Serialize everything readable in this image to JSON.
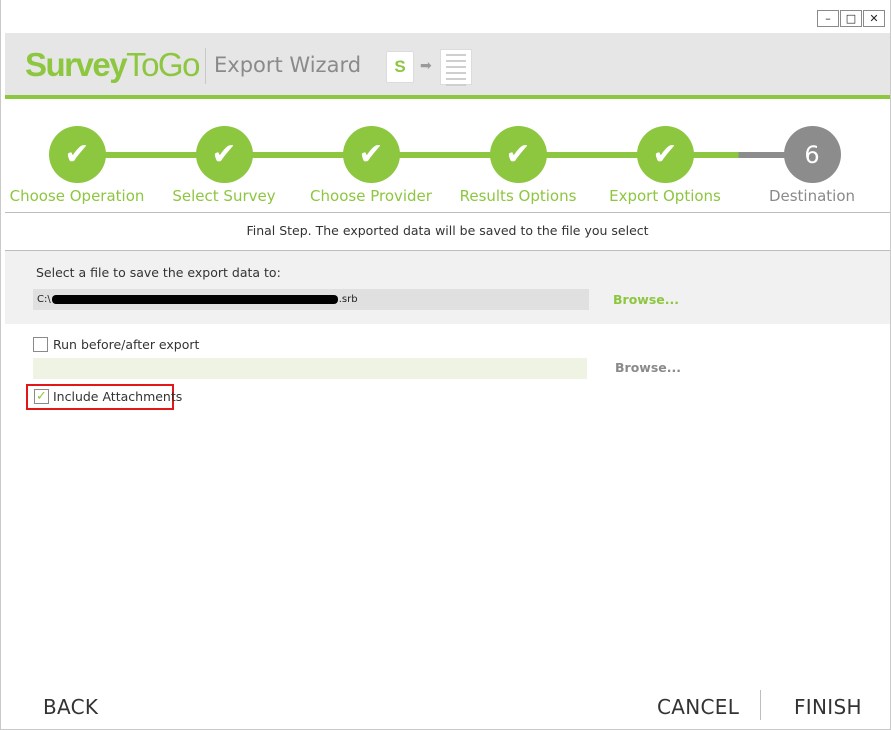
{
  "window": {
    "controls": {
      "minimize": "–",
      "maximize": "□",
      "close": "✕"
    }
  },
  "header": {
    "logo_part1": "Survey",
    "logo_part2": "ToGo",
    "title": "Export Wizard",
    "icon_letter": "S",
    "icon_arrow": "➡"
  },
  "colors": {
    "accent_green": "#8dc63f",
    "step_current_gray": "#8c8c8c",
    "highlight_red": "#e01818"
  },
  "steps": [
    {
      "label": "Choose Operation",
      "state": "done",
      "glyph": "✔"
    },
    {
      "label": "Select Survey",
      "state": "done",
      "glyph": "✔"
    },
    {
      "label": "Choose Provider",
      "state": "done",
      "glyph": "✔"
    },
    {
      "label": "Results Options",
      "state": "done",
      "glyph": "✔"
    },
    {
      "label": "Export Options",
      "state": "done",
      "glyph": "✔"
    },
    {
      "label": "Destination",
      "state": "current",
      "glyph": "6"
    }
  ],
  "final_message": "Final Step. The exported data will be saved to the file you select",
  "file_section": {
    "label": "Select a file to save the export data to:",
    "path_prefix": "C:\\",
    "path_suffix": ".srb",
    "browse_label": "Browse..."
  },
  "options": {
    "run_label": "Run before/after export",
    "run_checked": false,
    "run_browse_label": "Browse...",
    "attachments_label": "Include Attachments",
    "attachments_checked": true,
    "check_glyph": "✓"
  },
  "footer": {
    "back": "BACK",
    "cancel": "CANCEL",
    "finish": "FINISH"
  }
}
